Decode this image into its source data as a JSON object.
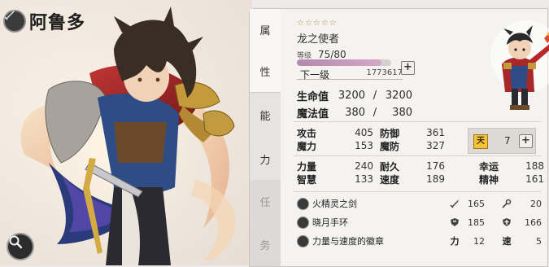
{
  "hero": {
    "name": "阿鲁多",
    "class_icon": "sword-class-icon",
    "title": "龙之使者",
    "stars": "☆☆☆☆☆"
  },
  "tabs": [
    {
      "label": "属",
      "label2": "性"
    },
    {
      "label": "能",
      "label2": "力"
    },
    {
      "label": "任",
      "label2": "务"
    }
  ],
  "level": {
    "label": "等级",
    "current": "75",
    "max": "80",
    "separator": "/",
    "progress": 0.9
  },
  "next_level": {
    "label": "下一级",
    "value": "1773617"
  },
  "vitals": [
    {
      "label": "生命值",
      "current": "3200",
      "sep": "/",
      "max": "3200"
    },
    {
      "label": "魔法值",
      "current": "380",
      "sep": "/",
      "max": "380"
    }
  ],
  "stats_a": [
    {
      "l1": "攻击",
      "v1": "405",
      "l2": "防御",
      "v2": "361"
    },
    {
      "l1": "魔力",
      "v1": "153",
      "l2": "魔防",
      "v2": "327"
    }
  ],
  "fate": {
    "icon_text": "天",
    "value": "7"
  },
  "stats_b": [
    {
      "l1": "力量",
      "v1": "240",
      "l2": "耐久",
      "v2": "176",
      "l3": "幸运",
      "v3": "188"
    },
    {
      "l1": "智慧",
      "v1": "133",
      "l2": "速度",
      "v2": "189",
      "l3": "精神",
      "v3": "161"
    }
  ],
  "equipment": [
    {
      "name": "火精灵之剑",
      "s1_icon": "sword-icon",
      "s1_val": "165",
      "s2_icon": "magic-staff-icon",
      "s2_val": "20"
    },
    {
      "name": "晓月手环",
      "s1_icon": "shield-icon",
      "s1_val": "185",
      "s2_icon": "cross-shield-icon",
      "s2_val": "166"
    },
    {
      "name": "力量与速度的徽章",
      "s1_text": "力",
      "s1_val": "12",
      "s2_text": "速",
      "s2_val": "5"
    }
  ],
  "plus_symbol": "+"
}
